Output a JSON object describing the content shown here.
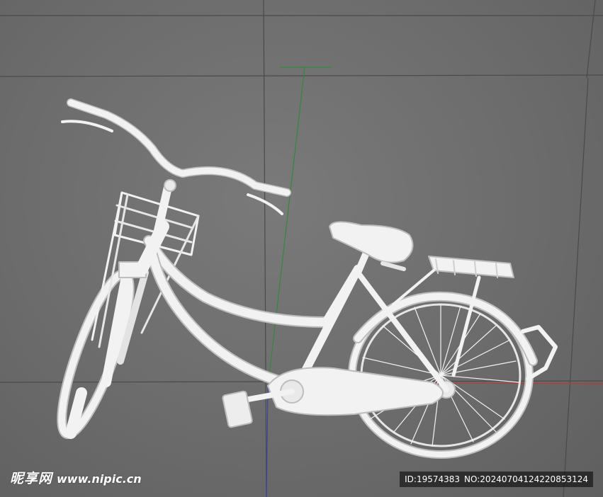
{
  "scene": {
    "subject": "bicycle-3d-model",
    "colors": {
      "background": "#6e6e6e",
      "grid_line": "#4a4a4a",
      "model": "#f2f2f2",
      "model_shadow": "#bdbdbd",
      "axis_x": "#c0392b",
      "axis_y": "#2e8b3a",
      "axis_z": "#3344aa"
    }
  },
  "watermark": {
    "logo_text": "昵享网",
    "url_text": "www.nipic.cn",
    "id_text": "ID:19574383",
    "no_text": "NO:20240704124220853124"
  }
}
